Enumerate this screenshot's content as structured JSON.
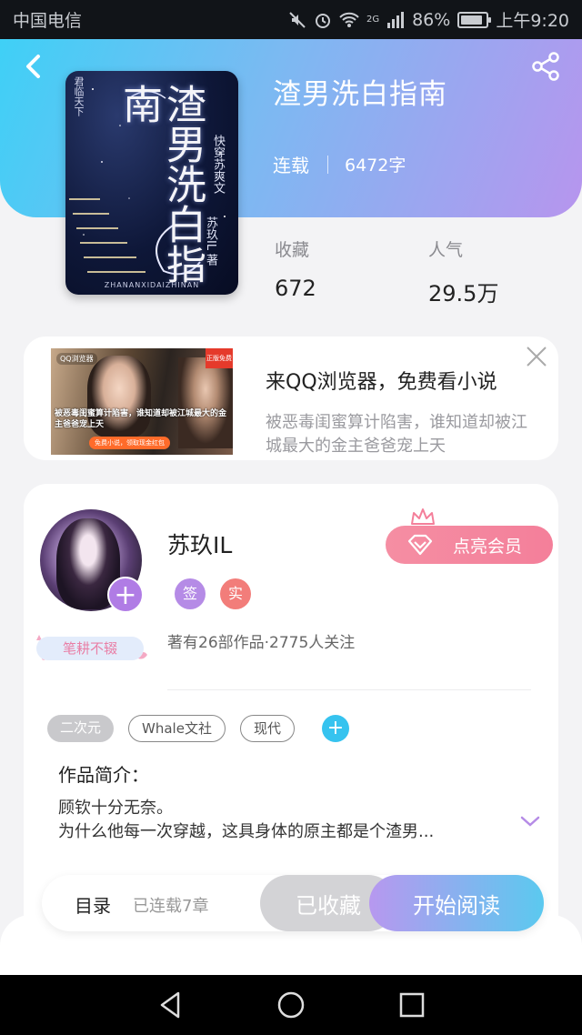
{
  "status_bar": {
    "carrier": "中国电信",
    "network": "2G",
    "battery": "86%",
    "battery_level": 0.86,
    "time": "上午9:20"
  },
  "book": {
    "title": "渣男洗白指南",
    "status": "连载",
    "word_count": "6472字",
    "stats": [
      {
        "label": "收藏",
        "value": "672"
      },
      {
        "label": "人气",
        "value": "29.5万"
      }
    ],
    "cover": {
      "title_art": "渣男洗白指南",
      "series": "快穿苏爽文",
      "author": "苏玖IL 著",
      "corner": "君临天下",
      "latin": "ZHANANXIDAIZHINAN"
    }
  },
  "ad": {
    "title": "来QQ浏览器，免费看小说",
    "description_line1": "被恶毒闺蜜算计陷害，谁知道却被江",
    "description_line2": "城最大的金主爸爸宠上天",
    "image": {
      "logo": "QQ浏览器",
      "badge": "正版免费",
      "caption": "被恶毒闺蜜算计陷害，谁知道却被江城最大的金主爸爸宠上天",
      "cta": "免费小说，领取现金红包"
    }
  },
  "author": {
    "name": "苏玖IL",
    "badge_sign": "签",
    "badge_real": "实",
    "info": "著有26部作品·2775人关注",
    "medal": "笔耕不辍",
    "vip_button": "点亮会员"
  },
  "tags": [
    "二次元",
    "Whale文社",
    "现代"
  ],
  "intro": {
    "title": "作品简介：",
    "line1": "顾钦十分无奈。",
    "line2": "为什么他每一次穿越，这具身体的原主都是个渣男..."
  },
  "actions": {
    "toc": "目录",
    "chapters": "已连载7章",
    "collected": "已收藏",
    "start_reading": "开始阅读"
  },
  "colors": {
    "header_gradient_start": "#3fd0f6",
    "header_gradient_end": "#b795ee",
    "vip_pink": "#f47f9a",
    "accent_purple": "#b07ce5",
    "accent_blue": "#36c3ef"
  }
}
